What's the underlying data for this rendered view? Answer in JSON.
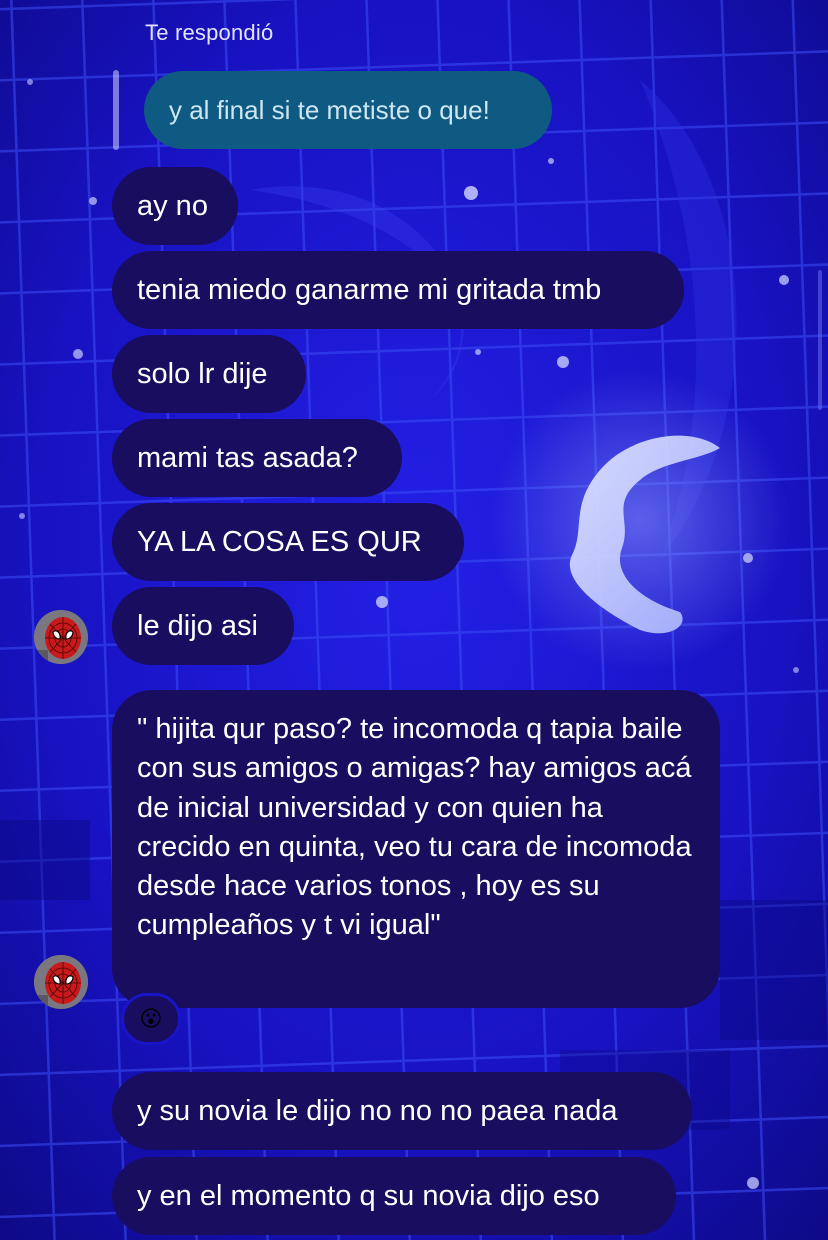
{
  "reply": {
    "header": "Te respondió",
    "quoted_text": "y al final si te metiste o que!"
  },
  "messages": [
    {
      "text": "ay no"
    },
    {
      "text": "tenia miedo ganarme mi gritada tmb"
    },
    {
      "text": "solo lr dije"
    },
    {
      "text": "mami tas asada?"
    },
    {
      "text": "YA LA COSA ES QUR"
    },
    {
      "text": "le dijo asi"
    },
    {
      "text": "\" hijita qur paso? te incomoda q tapia baile con sus amigos o amigas? hay amigos acá de inicial universidad y con quien ha crecido en quinta, veo tu cara de incomoda desde hace varios tonos , hoy es su cumpleaños y t vi igual\""
    },
    {
      "text": "y su novia le dijo no no no paea nada"
    },
    {
      "text": "y en el momento q su novia dijo eso"
    }
  ],
  "reaction": {
    "emoji": "😮",
    "icon": "surprised-face-emoji"
  },
  "avatar": {
    "icon": "spiderman-avatar"
  },
  "theme": {
    "background": "#1a14c8",
    "bubble": "#180d5e",
    "reply_bubble": "#0e5a82",
    "text": "#ffffff"
  }
}
